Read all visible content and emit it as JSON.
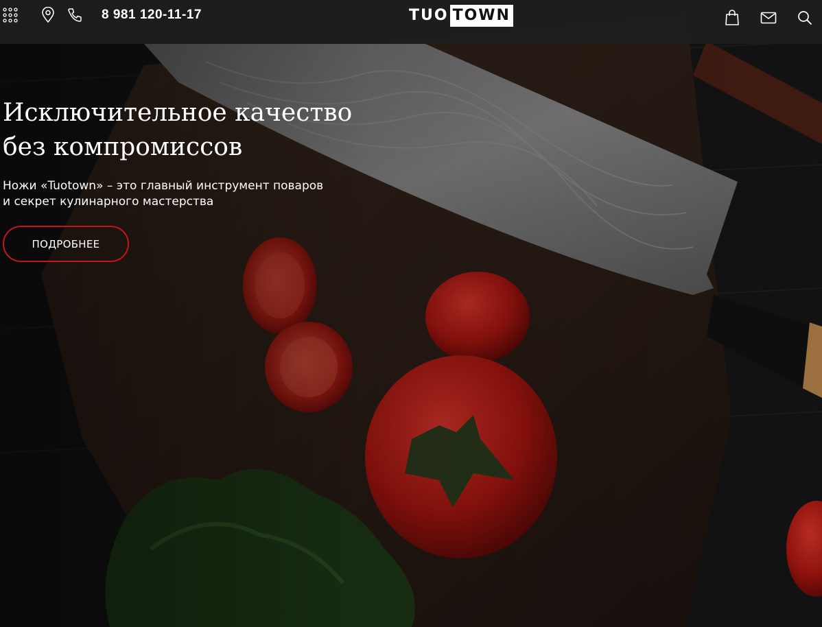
{
  "header": {
    "phone": "8 981 120-11-17",
    "logo": {
      "part1": "TUO",
      "part2": "TOWN"
    },
    "icons": {
      "menu": "grid-dots-icon",
      "location": "location-pin-icon",
      "call": "phone-icon",
      "cart": "shopping-bag-icon",
      "mail": "mail-icon",
      "search": "search-icon"
    }
  },
  "hero": {
    "title": "Исключительное качество без компромиссов",
    "subtitle": "Ножи «Tuotown» – это главный инструмент поваров и секрет кулинарного мастерства",
    "button_label": "ПОДРОБНЕЕ"
  },
  "colors": {
    "accent": "#c4161c",
    "header_bg": "#1e1e1e",
    "text": "#ffffff"
  }
}
